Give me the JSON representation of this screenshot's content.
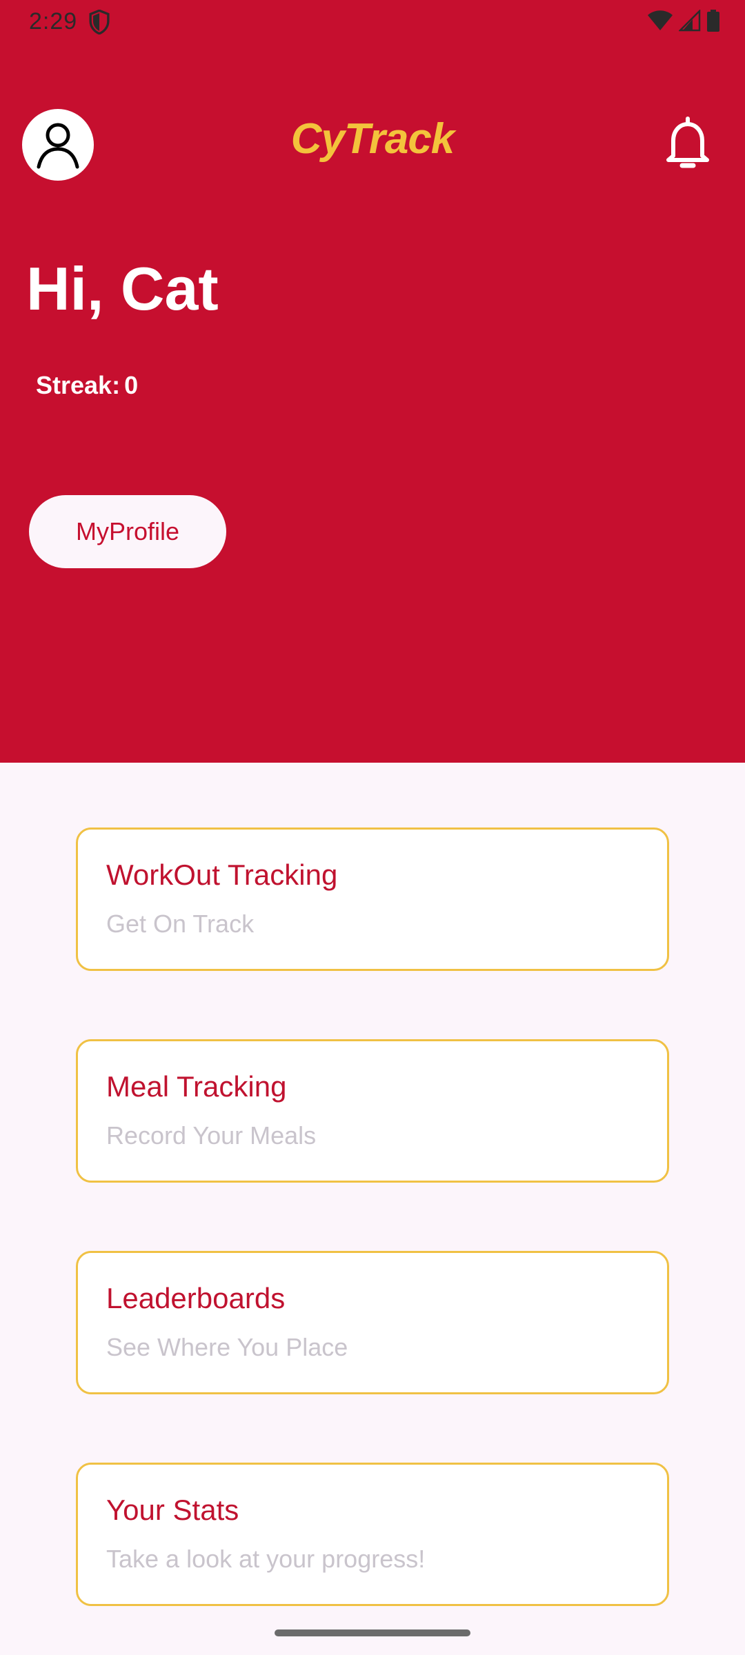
{
  "status_bar": {
    "time": "2:29"
  },
  "header": {
    "app_title": "CyTrack"
  },
  "greeting": "Hi, Cat",
  "streak": {
    "label": "Streak:",
    "value": "0"
  },
  "profile_button": "MyProfile",
  "cards": [
    {
      "title": "WorkOut Tracking",
      "subtitle": "Get On Track"
    },
    {
      "title": "Meal Tracking",
      "subtitle": "Record Your Meals"
    },
    {
      "title": "Leaderboards",
      "subtitle": "See Where You Place"
    },
    {
      "title": "Your Stats",
      "subtitle": "Take a look at your progress!"
    }
  ],
  "colors": {
    "primary_red": "#c60f2f",
    "accent_gold": "#f3c33c",
    "card_border": "#f0c144",
    "background": "#fcf5fb"
  },
  "icons": [
    "shield-icon",
    "wifi-icon",
    "signal-icon",
    "battery-icon",
    "profile-avatar-icon",
    "bell-icon"
  ]
}
